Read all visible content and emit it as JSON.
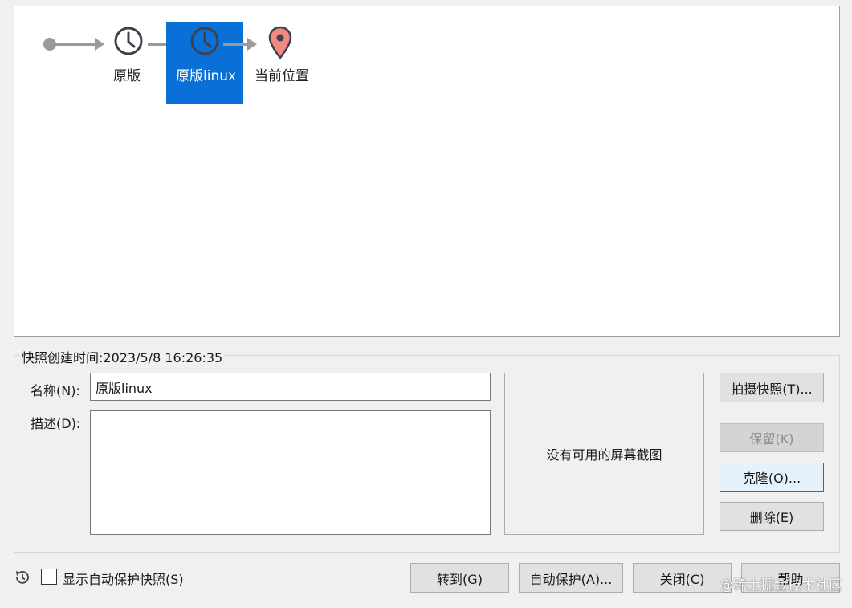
{
  "tree": {
    "nodes": [
      {
        "label": "原版",
        "icon": "clock-icon"
      },
      {
        "label": "原版linux",
        "icon": "clock-icon",
        "selected": true
      },
      {
        "label": "当前位置",
        "icon": "location-pin-icon"
      }
    ]
  },
  "details": {
    "created_time": "快照创建时间:2023/5/8 16:26:35",
    "name_label": "名称(N):",
    "name_value": "原版linux",
    "description_label": "描述(D):",
    "description_value": "",
    "screenshot_text": "没有可用的屏幕截图"
  },
  "side_buttons": {
    "take_snapshot": "拍摄快照(T)...",
    "keep": "保留(K)",
    "clone": "克隆(O)...",
    "delete": "删除(E)"
  },
  "footer": {
    "show_autoprotect_label": "显示自动保护快照(S)",
    "goto": "转到(G)",
    "autoprotect": "自动保护(A)...",
    "close": "关闭(C)",
    "help": "帮助"
  },
  "watermark": "@稀土掘金技术社区",
  "colors": {
    "selection": "#0a6fd6",
    "pin": "#f08a84",
    "focus_border": "#0078d7"
  }
}
